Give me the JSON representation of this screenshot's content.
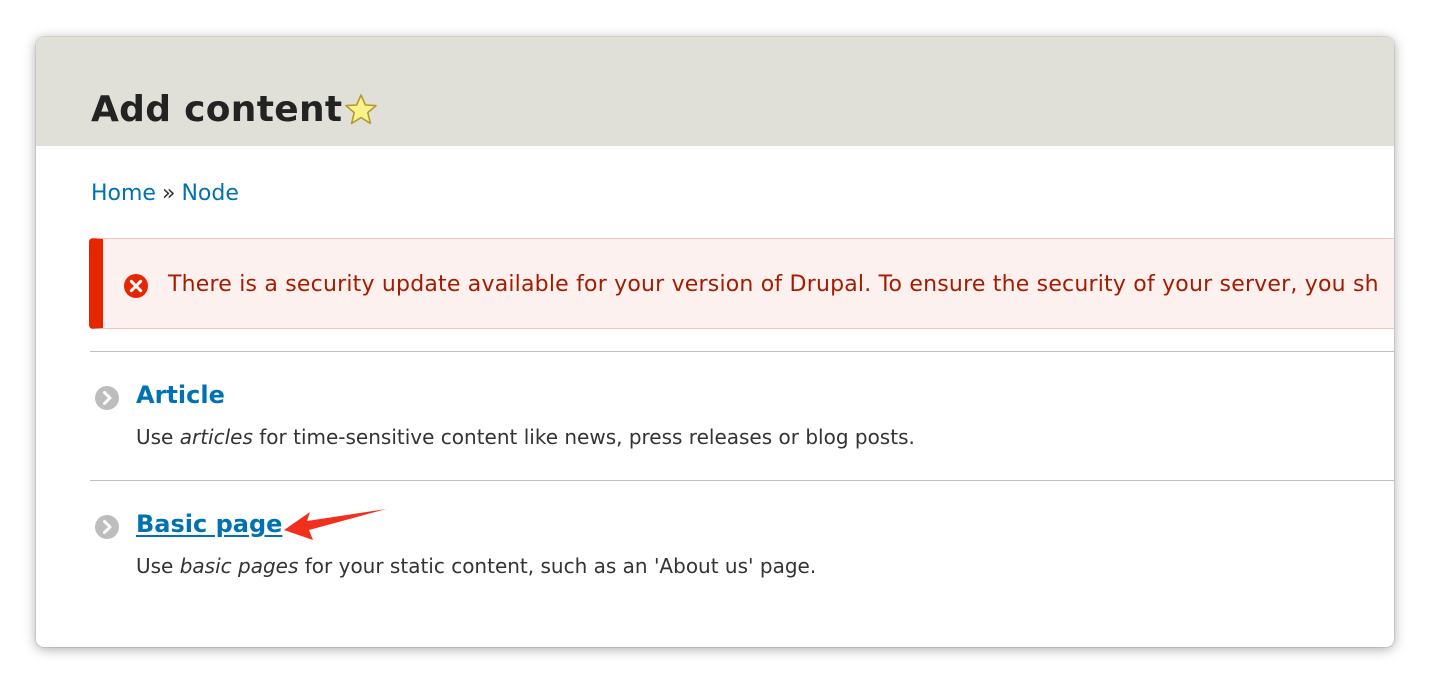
{
  "header": {
    "title": "Add content",
    "shortcut_icon": "star-icon"
  },
  "breadcrumb": {
    "items": [
      "Home",
      "Node"
    ],
    "separator": "»"
  },
  "message": {
    "type": "error",
    "icon": "error-x-icon",
    "text": "There is a security update available for your version of Drupal. To ensure the security of your server, you sh"
  },
  "content_types": [
    {
      "label": "Article",
      "icon": "chevron-right-circle-icon",
      "description_pre": "Use ",
      "description_em": "articles",
      "description_post": " for time-sensitive content like news, press releases or blog posts."
    },
    {
      "label": "Basic page",
      "icon": "chevron-right-circle-icon",
      "description_pre": "Use ",
      "description_em": "basic pages",
      "description_post": " for your static content, such as an 'About us' page."
    }
  ],
  "annotation": {
    "icon": "red-pointer-arrow-icon",
    "color": "#f0301c"
  },
  "colors": {
    "link": "#0071b3",
    "header_bg": "#e0e0d8",
    "error_border": "#e62600",
    "error_text": "#a51b00",
    "error_bg": "#fcf1ef"
  }
}
